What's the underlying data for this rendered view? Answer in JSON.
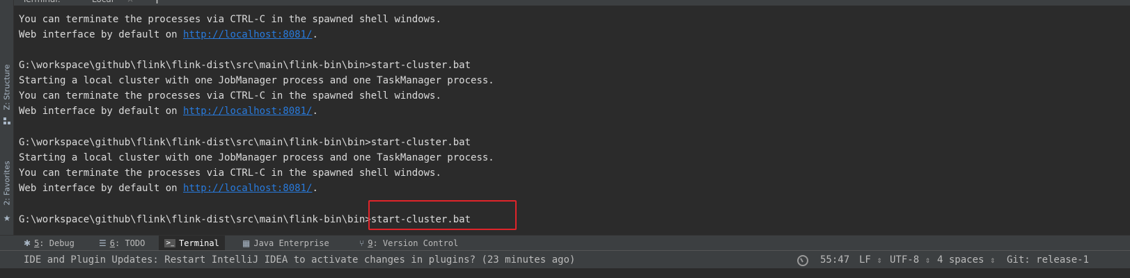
{
  "tabs": {
    "terminal_label": "Terminal:",
    "local_tab_label": "Local",
    "close_glyph": "×",
    "add_glyph": "+"
  },
  "left_stripe": {
    "structure_label": "Z: Structure",
    "favorites_label": "2: Favorites"
  },
  "terminal": {
    "lines": [
      {
        "type": "text",
        "text": "You can terminate the processes via CTRL-C in the spawned shell windows."
      },
      {
        "type": "web",
        "prefix": "Web interface by default on ",
        "link": "http://localhost:8081/",
        "suffix": "."
      },
      {
        "type": "blank",
        "text": ""
      },
      {
        "type": "text",
        "text": "G:\\workspace\\github\\flink\\flink-dist\\src\\main\\flink-bin\\bin>start-cluster.bat"
      },
      {
        "type": "text",
        "text": "Starting a local cluster with one JobManager process and one TaskManager process."
      },
      {
        "type": "text",
        "text": "You can terminate the processes via CTRL-C in the spawned shell windows."
      },
      {
        "type": "web",
        "prefix": "Web interface by default on ",
        "link": "http://localhost:8081/",
        "suffix": "."
      },
      {
        "type": "blank",
        "text": ""
      },
      {
        "type": "text",
        "text": "G:\\workspace\\github\\flink\\flink-dist\\src\\main\\flink-bin\\bin>start-cluster.bat"
      },
      {
        "type": "text",
        "text": "Starting a local cluster with one JobManager process and one TaskManager process."
      },
      {
        "type": "text",
        "text": "You can terminate the processes via CTRL-C in the spawned shell windows."
      },
      {
        "type": "web",
        "prefix": "Web interface by default on ",
        "link": "http://localhost:8081/",
        "suffix": "."
      },
      {
        "type": "blank",
        "text": ""
      },
      {
        "type": "text",
        "text": "G:\\workspace\\github\\flink\\flink-dist\\src\\main\\flink-bin\\bin>start-cluster.bat"
      }
    ]
  },
  "tool_windows": {
    "debug_number": "5",
    "debug_label": ": Debug",
    "todo_number": "6",
    "todo_label": ": TODO",
    "terminal_label": "Terminal",
    "java_enterprise_label": "Java Enterprise",
    "vcs_number": "9",
    "vcs_label": ": Version Control"
  },
  "status": {
    "message": "IDE and Plugin Updates: Restart IntelliJ IDEA to activate changes in plugins? (23 minutes ago)",
    "position": "55:47",
    "line_separator": "LF",
    "encoding": "UTF-8",
    "indent": "4 spaces",
    "git_branch": "Git: release-1"
  },
  "colors": {
    "background": "#2b2b2b",
    "panel": "#3c3f41",
    "text": "#dcdcdc",
    "link": "#287bde",
    "highlight_box": "#e0242a"
  }
}
